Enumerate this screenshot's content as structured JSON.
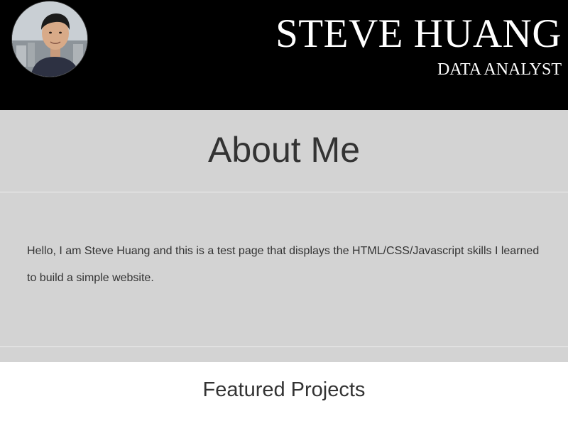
{
  "header": {
    "name": "STEVE HUANG",
    "role": "DATA ANALYST",
    "avatar_alt": "profile photo"
  },
  "about": {
    "title": "About Me",
    "text": "Hello, I am Steve Huang and this is a test page that displays the HTML/CSS/Javascript skills I learned to build a simple website."
  },
  "featured": {
    "title": "Featured Projects"
  },
  "colors": {
    "header_bg": "#000000",
    "about_bg": "#d3d3d3",
    "text": "#333333"
  }
}
